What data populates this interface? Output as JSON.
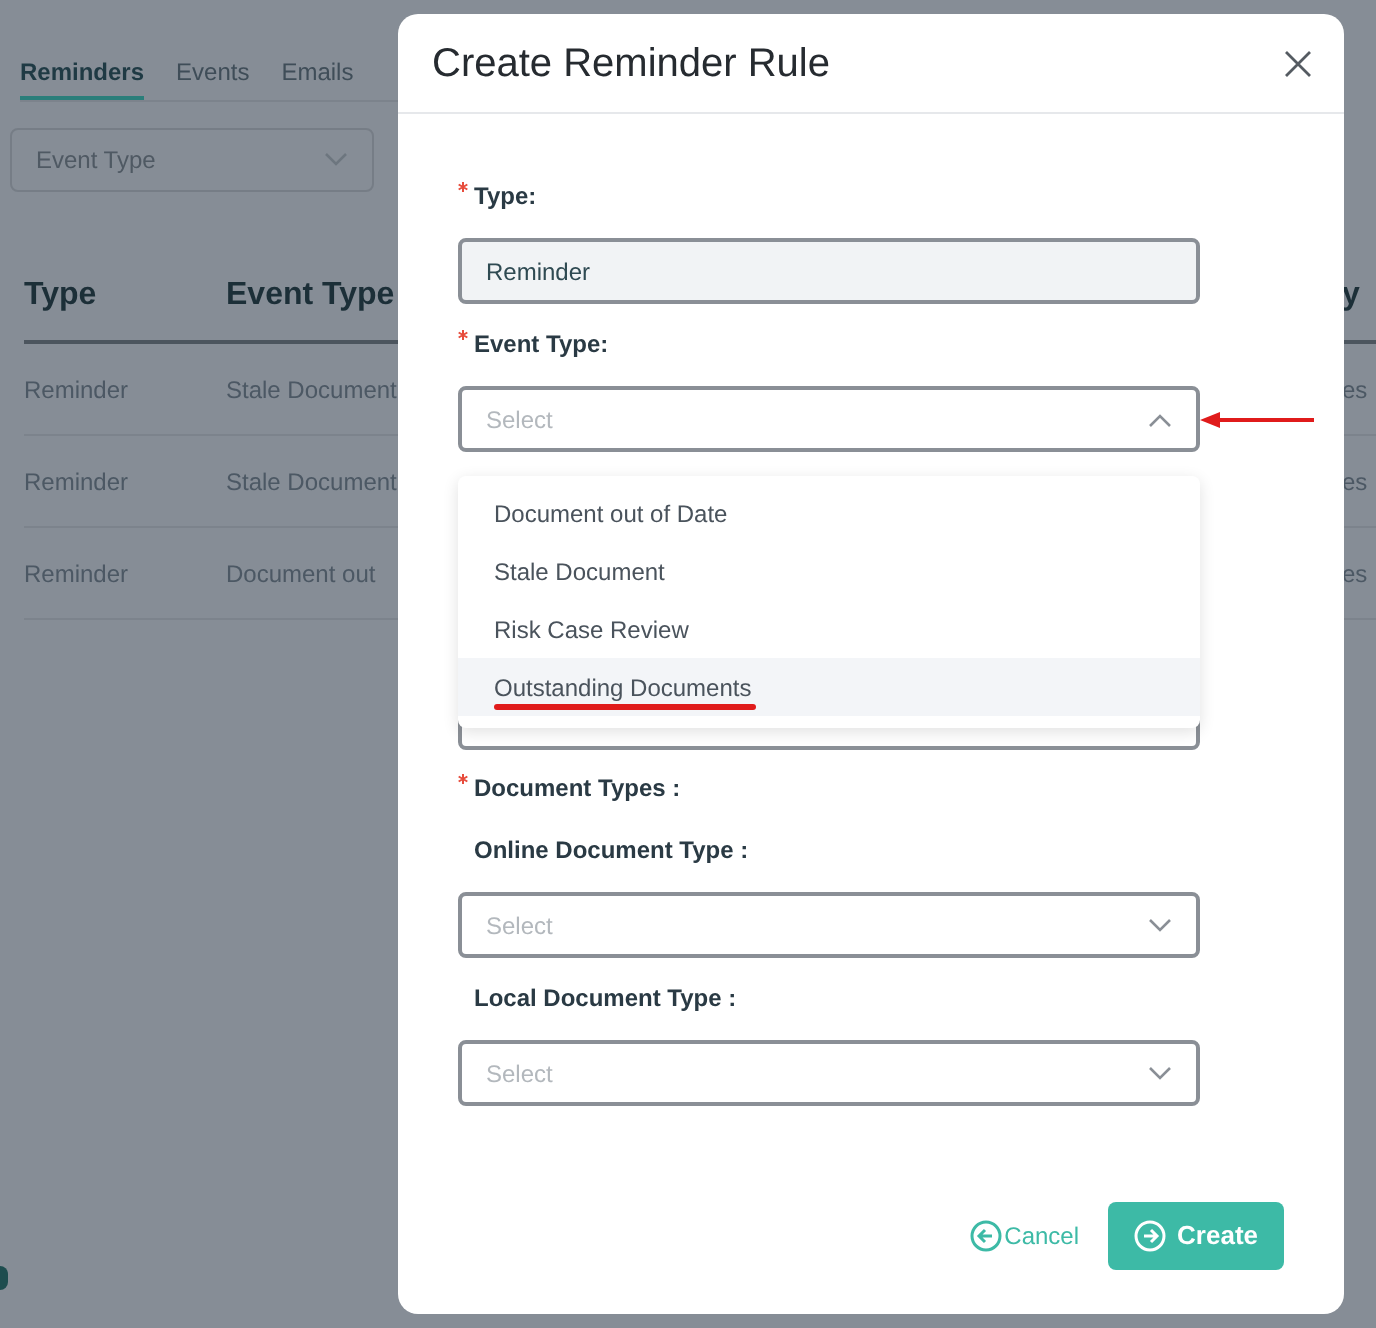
{
  "background": {
    "tabs": [
      {
        "label": "Reminders",
        "selected": true
      },
      {
        "label": "Events",
        "selected": false
      },
      {
        "label": "Emails",
        "selected": false
      }
    ],
    "filter": {
      "placeholder": "Event Type"
    },
    "table": {
      "columns": [
        "Type",
        "Event Type",
        "y"
      ],
      "rows": [
        [
          "Reminder",
          "Stale Document",
          "es"
        ],
        [
          "Reminder",
          "Stale Document",
          "es"
        ],
        [
          "Reminder",
          "Document out",
          "es"
        ]
      ]
    }
  },
  "dialog": {
    "title": "Create Reminder Rule",
    "fields": [
      {
        "label": "Type:",
        "required": true,
        "kind": "text",
        "value": "Reminder"
      },
      {
        "label": "Event Type:",
        "required": true,
        "kind": "select",
        "placeholder": "Select",
        "expanded": true,
        "pointed_at": true
      }
    ],
    "dropdown": [
      {
        "label": "Document out of Date",
        "highlighted": false,
        "underlined": false
      },
      {
        "label": "Stale Document",
        "highlighted": false,
        "underlined": false
      },
      {
        "label": "Risk Case Review",
        "highlighted": false,
        "underlined": false
      },
      {
        "label": "Outstanding Documents",
        "highlighted": true,
        "underlined": true
      }
    ],
    "section": {
      "label": "Document Types :",
      "required": true
    },
    "subfields": [
      {
        "label": "Online Document Type :",
        "placeholder": "Select",
        "expanded": false
      },
      {
        "label": "Local Document Type :",
        "placeholder": "Select",
        "expanded": false
      }
    ],
    "buttons": [
      {
        "label": "Cancel",
        "kind": "link"
      },
      {
        "label": "Create",
        "kind": "primary"
      }
    ]
  }
}
